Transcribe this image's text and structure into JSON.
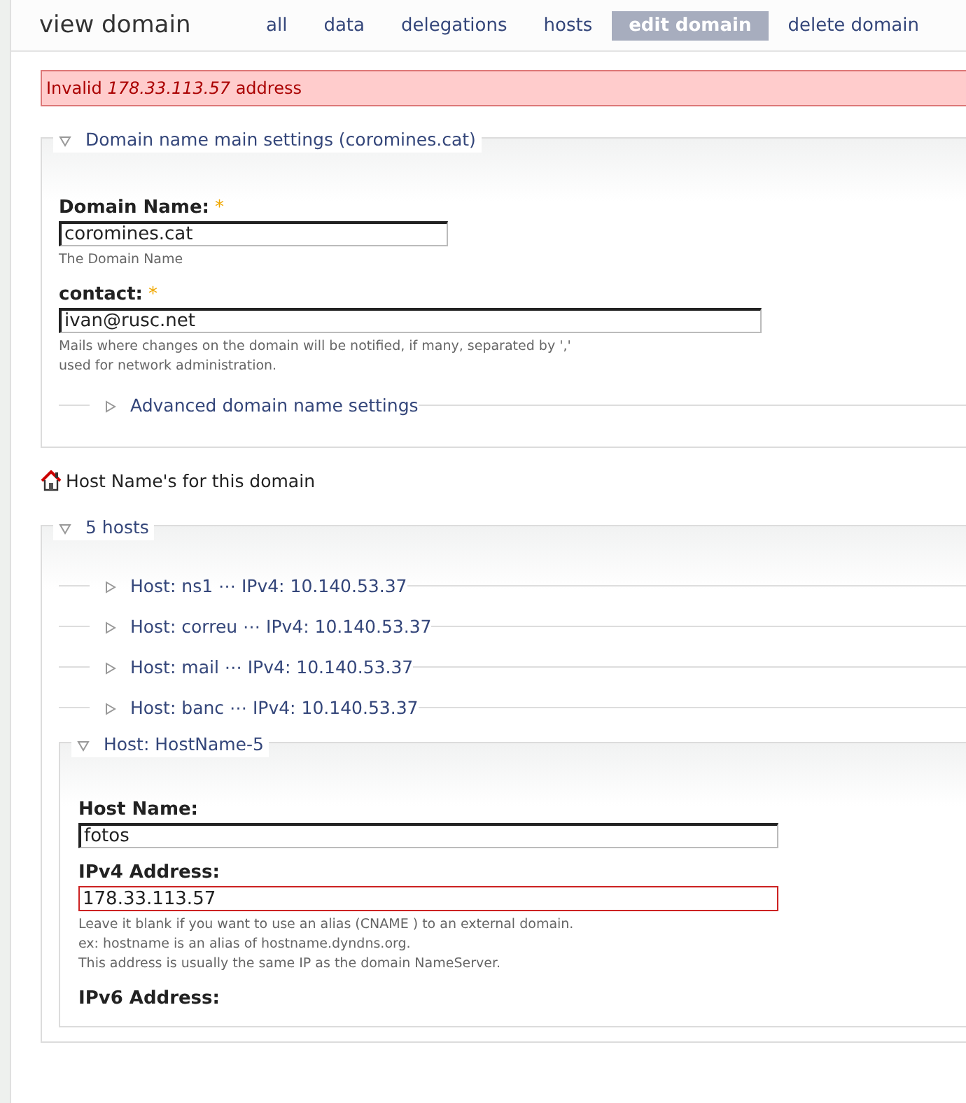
{
  "header": {
    "title": "view domain"
  },
  "tabs": [
    {
      "label": "all",
      "selected": false
    },
    {
      "label": "data",
      "selected": false
    },
    {
      "label": "delegations",
      "selected": false
    },
    {
      "label": "hosts",
      "selected": false
    },
    {
      "label": "edit domain",
      "selected": true
    },
    {
      "label": "delete domain",
      "selected": false
    }
  ],
  "error": "Invalid *178.33.113.57* address",
  "domain_settings": {
    "legend": "Domain name main settings (coromines.cat)",
    "expanded": true,
    "fields": [
      {
        "label": "Domain Name:",
        "marker": "*",
        "value": "coromines.cat",
        "invalid": false,
        "help": [
          "The Domain Name"
        ]
      },
      {
        "label": "contact:",
        "marker": "*",
        "value": "ivan@rusc.net",
        "invalid": false,
        "help": [
          "Mails where changes on the domain will be notified, if many, separated by ','",
          "used for network administration."
        ]
      }
    ],
    "advanced": {
      "legend": "Advanced domain name settings",
      "expanded": false
    }
  },
  "hosts_heading": "Host Name's for this domain",
  "hosts": {
    "legend": "5 hosts",
    "expanded": true,
    "items": [
      {
        "legend": "Host: ns1 ⋯ IPv4: 10.140.53.37",
        "expanded": false
      },
      {
        "legend": "Host: correu ⋯ IPv4: 10.140.53.37",
        "expanded": false
      },
      {
        "legend": "Host: mail ⋯ IPv4: 10.140.53.37",
        "expanded": false
      },
      {
        "legend": "Host: banc ⋯ IPv4: 10.140.53.37",
        "expanded": false
      },
      {
        "legend": "Host: HostName-5",
        "expanded": true,
        "fields": [
          {
            "label": "Host Name:",
            "value": "fotos",
            "invalid": false
          },
          {
            "label": "IPv4 Address:",
            "value": "178.33.113.57",
            "invalid": true,
            "help": [
              "Leave it blank if you want to use an alias (CNAME ) to an external domain.",
              "ex: hostname is an alias of hostname.dyndns.org.",
              "This address is usually the same IP as the domain NameServer."
            ]
          },
          {
            "label": "IPv6 Address:"
          }
        ]
      }
    ]
  }
}
